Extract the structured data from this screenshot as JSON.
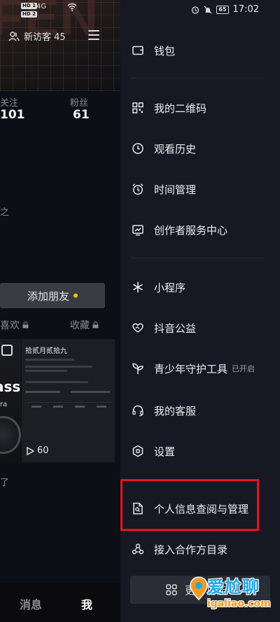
{
  "left": {
    "status": {
      "sim1": "HD 1",
      "sim2": "HD 2",
      "network": "4G"
    },
    "visitors_label": "新访客 45",
    "stats": {
      "following_label": "关注",
      "following_value": "101",
      "fans_label": "粉丝",
      "fans_value": "61"
    },
    "cut_text_1": "之",
    "add_friend_label": "添加朋友",
    "tabs": {
      "likes": "喜欢",
      "favorites": "收藏"
    },
    "thumb1": {
      "text": "ass",
      "subtext": "ra"
    },
    "thumb2": {
      "title": "拾贰月贰拾九",
      "play_count": "60"
    },
    "cut_text_2": "了",
    "nav": {
      "messages": "消息",
      "me": "我"
    }
  },
  "status_bar": {
    "battery": "65",
    "time": "17:02"
  },
  "menu": {
    "items": [
      {
        "id": "wallet",
        "label": "钱包",
        "icon": "wallet-icon"
      },
      {
        "id": "qrcode",
        "label": "我的二维码",
        "icon": "qrcode-icon"
      },
      {
        "id": "history",
        "label": "观看历史",
        "icon": "clock-icon"
      },
      {
        "id": "time",
        "label": "时间管理",
        "icon": "alarm-icon"
      },
      {
        "id": "creator",
        "label": "创作者服务中心",
        "icon": "chart-icon"
      },
      {
        "id": "miniapp",
        "label": "小程序",
        "icon": "asterisk-icon"
      },
      {
        "id": "charity",
        "label": "抖音公益",
        "icon": "heart-hand-icon"
      },
      {
        "id": "youth",
        "label": "青少年守护工具",
        "icon": "sprout-icon",
        "tag": "已开启"
      },
      {
        "id": "service",
        "label": "我的客服",
        "icon": "headset-icon"
      },
      {
        "id": "settings",
        "label": "设置",
        "icon": "hexagon-gear-icon"
      },
      {
        "id": "privacy",
        "label": "个人信息查阅与管理",
        "icon": "document-icon"
      },
      {
        "id": "partners",
        "label": "接入合作方目录",
        "icon": "partner-icon"
      }
    ],
    "more_label": "更多功能"
  },
  "watermark": {
    "brand": "爱尬聊",
    "url": "igaliao.com"
  },
  "colors": {
    "highlight": "#e5131c",
    "accent_dot": "#f2c500"
  }
}
